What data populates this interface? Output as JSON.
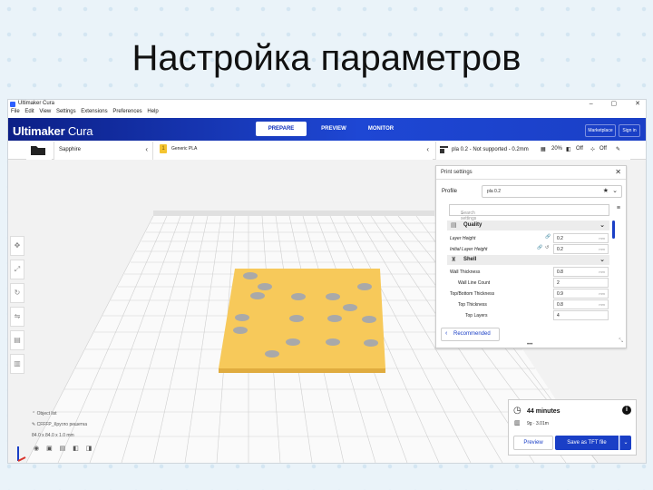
{
  "slide": {
    "title": "Настройка параметров"
  },
  "window": {
    "title": "Ultimaker Cura",
    "minimize": "–",
    "maximize": "▢",
    "close": "✕"
  },
  "menu": [
    "File",
    "Edit",
    "View",
    "Settings",
    "Extensions",
    "Preferences",
    "Help"
  ],
  "header": {
    "brand_bold": "Ultimaker",
    "brand_light": " Cura",
    "stages": [
      "PREPARE",
      "PREVIEW",
      "MONITOR"
    ],
    "active_stage": "PREPARE",
    "marketplace_label": "Marketplace",
    "signin_label": "Sign in"
  },
  "toolbar": {
    "printer_name": "Sapphire",
    "material_badge": "1",
    "material_name": "Generic PLA",
    "profile_summary": "pla 0.2 - Not supported - 0.2mm",
    "infill": "20%",
    "support": "Off",
    "adhesion": "Off"
  },
  "print_settings": {
    "header": "Print settings",
    "profile_label": "Profile",
    "profile_value": "pla 0.2",
    "search_placeholder": "Search settings",
    "categories": [
      {
        "name": "Quality",
        "settings": [
          {
            "label": "Layer Height",
            "value": "0.2",
            "unit": "mm"
          },
          {
            "label": "Initial Layer Height",
            "value": "0.2",
            "unit": "mm"
          }
        ]
      },
      {
        "name": "Shell",
        "settings": [
          {
            "label": "Wall Thickness",
            "value": "0.8",
            "unit": "mm"
          },
          {
            "label": "Wall Line Count",
            "value": "2",
            "unit": ""
          },
          {
            "label": "Top/Bottom Thickness",
            "value": "0.9",
            "unit": "mm"
          },
          {
            "label": "Top Thickness",
            "value": "0.8",
            "unit": "mm"
          },
          {
            "label": "Top Layers",
            "value": "4",
            "unit": ""
          }
        ]
      }
    ],
    "recommended_label": "Recommended",
    "more_dots": "•••"
  },
  "object_list": {
    "header": "Object list",
    "object_name": "CFFFP_Кругло решетка",
    "dimensions": "84.0 x 84.0 x 1.0 mm"
  },
  "action_panel": {
    "time": "44 minutes",
    "material_usage": "9g · 3.01m",
    "preview_label": "Preview",
    "save_label": "Save as TFT file",
    "info_glyph": "i"
  },
  "colors": {
    "brand_blue": "#1a3fc6",
    "model_yellow": "#f7c95a",
    "hole_gray": "#a9a9a9"
  }
}
